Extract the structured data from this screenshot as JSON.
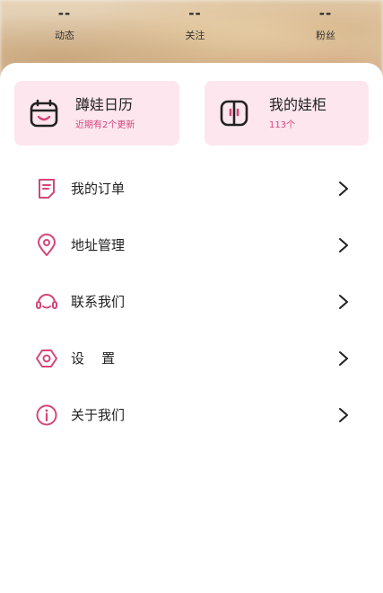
{
  "stats": [
    {
      "value": "--",
      "label": "动态"
    },
    {
      "value": "--",
      "label": "关注"
    },
    {
      "value": "--",
      "label": "粉丝"
    }
  ],
  "tiles": {
    "calendar": {
      "title": "蹲娃日历",
      "subtitle": "近期有2个更新",
      "icon": "calendar-face-icon"
    },
    "cabinet": {
      "title": "我的娃柜",
      "subtitle": "113个",
      "icon": "cabinet-icon"
    }
  },
  "menu": [
    {
      "label": "我的订单",
      "icon": "order-icon"
    },
    {
      "label": "地址管理",
      "icon": "location-pin-icon"
    },
    {
      "label": "联系我们",
      "icon": "headset-icon"
    },
    {
      "label": "设    置",
      "icon": "settings-hexagon-icon"
    },
    {
      "label": "关于我们",
      "icon": "info-icon"
    }
  ],
  "colors": {
    "accent": "#d4467a",
    "tile_bg": "#fde6ee",
    "icon_dark": "#222222"
  }
}
